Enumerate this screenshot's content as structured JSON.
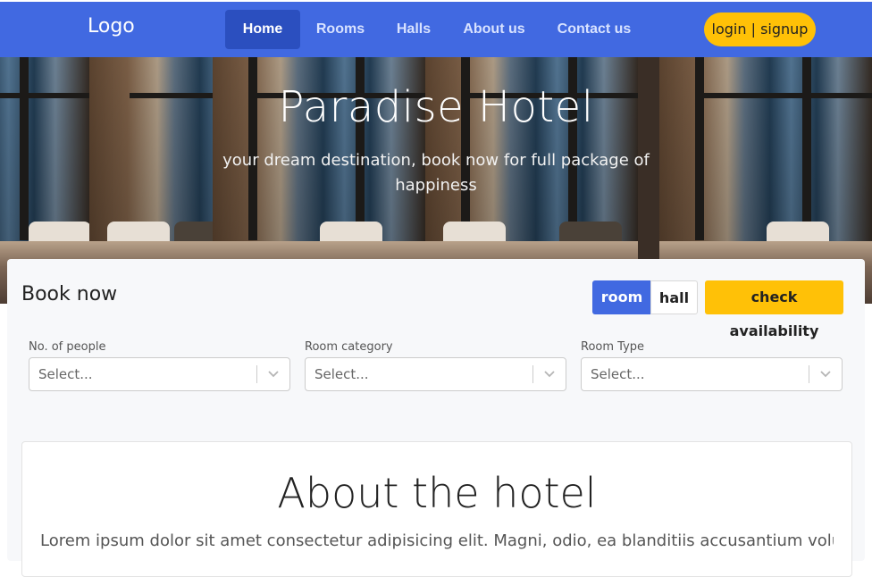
{
  "navbar": {
    "logo": "Logo",
    "items": [
      {
        "label": "Home",
        "active": true
      },
      {
        "label": "Rooms",
        "active": false
      },
      {
        "label": "Halls",
        "active": false
      },
      {
        "label": "About us",
        "active": false
      },
      {
        "label": "Contact us",
        "active": false
      }
    ],
    "login_label": "login | signup",
    "background": "#4169e1",
    "accent": "#ffc107"
  },
  "hero": {
    "title": "Paradise Hotel",
    "subtitle": "your dream destination, book now for full package of happiness"
  },
  "booking": {
    "title": "Book now",
    "toggles": {
      "room": "room",
      "hall": "hall",
      "selected": "room"
    },
    "check_label": "check availability",
    "fields": [
      {
        "label": "No. of people",
        "placeholder": "Select..."
      },
      {
        "label": "Room category",
        "placeholder": "Select..."
      },
      {
        "label": "Room Type",
        "placeholder": "Select..."
      }
    ]
  },
  "about": {
    "title": "About the hotel",
    "text": "Lorem ipsum dolor sit amet consectetur adipisicing elit. Magni, odio, ea blanditiis accusantium voluptates"
  }
}
